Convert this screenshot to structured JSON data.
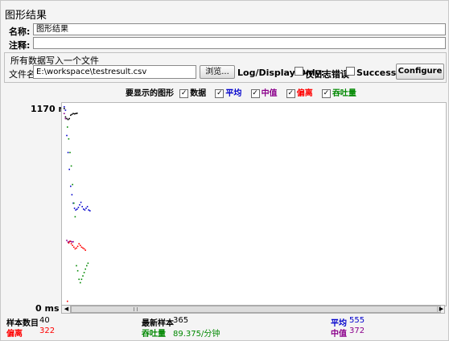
{
  "window": {
    "title": "图形结果"
  },
  "form": {
    "name_label": "名称:",
    "name_value": "图形结果",
    "comment_label": "注释:",
    "comment_value": ""
  },
  "file_group": {
    "legend": "所有数据写入一个文件",
    "filename_label": "文件名",
    "filename_value": "E:\\workspace\\testresult.csv",
    "browse_label": "浏览...",
    "log_display_label": "Log/Display Only:",
    "errors_only_label": "仅日志错误",
    "successes_label": "Successes",
    "configure_label": "Configure"
  },
  "legend_bar": {
    "prompt": "要显示的图形",
    "items": [
      {
        "label": "数据",
        "checked": true,
        "color": "#000000"
      },
      {
        "label": "平均",
        "checked": true,
        "color": "#0000cc"
      },
      {
        "label": "中值",
        "checked": true,
        "color": "#8b008b"
      },
      {
        "label": "偏离",
        "checked": true,
        "color": "#ff0000"
      },
      {
        "label": "吞吐量",
        "checked": true,
        "color": "#008800"
      }
    ]
  },
  "chart_data": {
    "type": "scatter",
    "y_axis": {
      "max_label": "1170 ms",
      "min_label": "0 ms",
      "ylim": [
        0,
        1170
      ]
    },
    "series": [
      {
        "name": "数据",
        "color": "#000000",
        "points": [
          [
            0,
            1160
          ],
          [
            1,
            1110
          ],
          [
            2,
            1100
          ],
          [
            3,
            1095
          ],
          [
            4,
            1100
          ],
          [
            5,
            1120
          ],
          [
            6,
            1125
          ],
          [
            7,
            1130
          ],
          [
            8,
            1128
          ],
          [
            9,
            1130
          ],
          [
            10,
            1132
          ]
        ]
      },
      {
        "name": "平均",
        "color": "#0000cc",
        "points": [
          [
            0,
            1170
          ],
          [
            1,
            1150
          ],
          [
            2,
            1000
          ],
          [
            3,
            900
          ],
          [
            4,
            800
          ],
          [
            5,
            700
          ],
          [
            6,
            650
          ],
          [
            7,
            600
          ],
          [
            8,
            570
          ],
          [
            9,
            560
          ],
          [
            10,
            565
          ],
          [
            11,
            575
          ],
          [
            12,
            590
          ],
          [
            13,
            605
          ],
          [
            14,
            580
          ],
          [
            15,
            565
          ],
          [
            16,
            560
          ],
          [
            17,
            570
          ],
          [
            18,
            580
          ],
          [
            19,
            560
          ],
          [
            20,
            555
          ]
        ]
      },
      {
        "name": "中值",
        "color": "#8b008b",
        "points": [
          [
            0,
            1130
          ],
          [
            1,
            1100
          ],
          [
            2,
            380
          ],
          [
            3,
            370
          ],
          [
            4,
            372
          ],
          [
            5,
            375
          ],
          [
            6,
            371
          ],
          [
            7,
            372
          ]
        ]
      },
      {
        "name": "偏离",
        "color": "#ff0000",
        "points": [
          [
            0,
            20
          ],
          [
            1,
            365
          ],
          [
            2,
            375
          ],
          [
            3,
            360
          ],
          [
            4,
            350
          ],
          [
            5,
            340
          ],
          [
            6,
            330
          ],
          [
            7,
            335
          ],
          [
            8,
            345
          ],
          [
            9,
            360
          ],
          [
            10,
            350
          ],
          [
            11,
            340
          ],
          [
            12,
            335
          ],
          [
            13,
            330
          ],
          [
            14,
            322
          ]
        ]
      },
      {
        "name": "吞吐量",
        "color": "#008800",
        "points": [
          [
            0,
            1050
          ],
          [
            1,
            980
          ],
          [
            2,
            900
          ],
          [
            3,
            820
          ],
          [
            4,
            710
          ],
          [
            5,
            600
          ],
          [
            6,
            520
          ],
          [
            7,
            230
          ],
          [
            8,
            200
          ],
          [
            9,
            150
          ],
          [
            10,
            130
          ],
          [
            11,
            150
          ],
          [
            12,
            170
          ],
          [
            13,
            190
          ],
          [
            14,
            210
          ],
          [
            15,
            230
          ],
          [
            16,
            245
          ]
        ]
      }
    ]
  },
  "stats": {
    "samples_label": "样本数目",
    "samples_value": "40",
    "latest_label": "最新样本",
    "latest_value": "365",
    "avg_label": "平均",
    "avg_value": "555",
    "dev_label": "偏离",
    "dev_value": "322",
    "tput_label": "吞吐量",
    "tput_value": "89.375/分钟",
    "median_label": "中值",
    "median_value": "372"
  }
}
